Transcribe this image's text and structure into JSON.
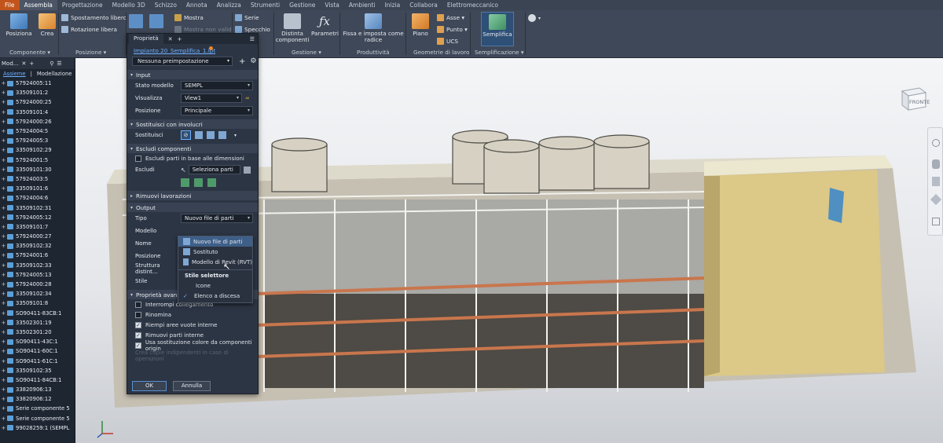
{
  "menubar": {
    "items": [
      "File",
      "Assembla",
      "Progettazione",
      "Modello 3D",
      "Schizzo",
      "Annota",
      "Analizza",
      "Strumenti",
      "Gestione",
      "Vista",
      "Ambienti",
      "Inizia",
      "Collabora",
      "Elettromeccanico"
    ],
    "active": "Assembla"
  },
  "ribbon": {
    "componente": {
      "posiziona": "Posiziona",
      "crea": "Crea",
      "group": "Componente ▾"
    },
    "posizione": {
      "spostamento": "Spostamento libero",
      "rotazione": "Rotazione libera",
      "group": "Posizione ▾"
    },
    "relazioni": {
      "mostra": "Mostra",
      "mostra_non_validi": "Mostra non validi"
    },
    "modello": {
      "serie": "Serie",
      "specchio": "Specchio"
    },
    "gestione": {
      "distinta": "Distinta componenti",
      "parametri": "Parametri",
      "group": "Gestione ▾"
    },
    "produttivita": {
      "fissa": "Fissa e imposta come radice",
      "group": "Produttività"
    },
    "geometrie": {
      "piano": "Piano",
      "asse": "Asse ▾",
      "punto": "Punto ▾",
      "ucs": "UCS",
      "group": "Geometrie di lavoro"
    },
    "semplificazione": {
      "semplifica": "Semplifica",
      "group": "Semplificazione ▾"
    }
  },
  "browser": {
    "header": "Mod...",
    "tab_assieme": "Assieme",
    "tab_modellazione": "Modellazione",
    "items": [
      "57924005:11",
      "33509101:2",
      "57924000:25",
      "33509101:4",
      "57924000:26",
      "57924004:5",
      "57924005:3",
      "33509102:29",
      "57924001:5",
      "33509101:30",
      "57924003:5",
      "33509101:6",
      "57924004:6",
      "33509102:31",
      "57924005:12",
      "33509101:7",
      "57924000:27",
      "33509102:32",
      "57924001:6",
      "33509102:33",
      "57924005:13",
      "57924000:28",
      "33509102:34",
      "33509101:8",
      "SO90411-83CB:1",
      "33502301:19",
      "33502301:20",
      "SO90411-43C:1",
      "SO90411-60C:1",
      "SO90411-61C:1",
      "33509102:35",
      "SO90411-84CB:1",
      "33820906:13",
      "33820906:12",
      "Serie componente 5",
      "Serie componente 5",
      "99028259:1 (SEMPL"
    ]
  },
  "panel": {
    "tab": "Proprietà",
    "file_link": "Impianto 20_Semplifica_1.ipt",
    "preset": "Nessuna preimpostazione",
    "input": {
      "title": "Input",
      "stato_label": "Stato modello",
      "stato_value": "SEMPL",
      "visualizza_label": "Visualizza",
      "visualizza_value": "View1",
      "posizione_label": "Posizione",
      "posizione_value": "Principale"
    },
    "sostituisci": {
      "title": "Sostituisci con involucri",
      "label": "Sostituisci"
    },
    "escludi": {
      "title": "Escludi componenti",
      "escludi_dim": "Escludi parti in base alle dimensioni",
      "label": "Escludi",
      "seleziona": "Seleziona parti"
    },
    "rimuovi": {
      "title": "Rimuovi lavorazioni"
    },
    "output": {
      "title": "Output",
      "tipo_label": "Tipo",
      "tipo_value": "Nuovo file di parti",
      "modello_label": "Modello",
      "nome_label": "Nome",
      "posizione_label": "Posizione",
      "struttura_label": "Struttura distint...",
      "stile_label": "Stile"
    },
    "avanzate": {
      "title": "Proprietà avanzate",
      "items": [
        {
          "label": "Interrompi collegamento",
          "checked": false
        },
        {
          "label": "Rinomina",
          "checked": false
        },
        {
          "label": "Riempi aree vuote interne",
          "checked": true
        },
        {
          "label": "Rimuovi parti interne",
          "checked": true
        },
        {
          "label": "Usa sostituzione colore da componenti origin",
          "checked": true
        }
      ],
      "faded": "Crea copie indipendenti in caso di operazioni"
    },
    "ok": "OK",
    "annulla": "Annulla"
  },
  "popup": {
    "items": [
      "Nuovo file di parti",
      "Sostituto",
      "Modello di Revit (RVT)"
    ],
    "selected": "Nuovo file di parti",
    "header": "Stile selettore",
    "icone": "Icone",
    "elenco": "Elenco a discesa"
  },
  "viewcube": {
    "label": "FRONTE"
  },
  "colors": {
    "file_tab": "#c2541b",
    "link": "#6fb1ff",
    "accent": "#3e5f88"
  }
}
